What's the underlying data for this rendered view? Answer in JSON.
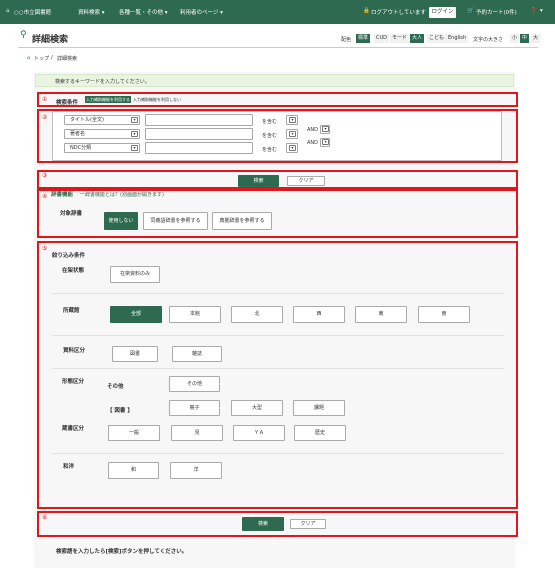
{
  "nav": {
    "site_title": "○○市立図書館",
    "menu": [
      "資料検索 ▾",
      "各種一覧・その他 ▾",
      "利用者のページ ▾"
    ],
    "logout_status": "ログアウトしています",
    "login_label": "ログイン",
    "cart_label": "予約カート(0件)",
    "help_label": "▾"
  },
  "header": {
    "page_title": "詳細検索",
    "color_label": "配色",
    "color_options": [
      "標準",
      "CUD",
      "モード"
    ],
    "lang_options": [
      "大人",
      "こども",
      "English"
    ],
    "fontsize_label": "文字の大きさ",
    "fontsize_options": [
      "小",
      "中",
      "大"
    ]
  },
  "breadcrumb": {
    "home": "トップ",
    "separator": "/",
    "current": "詳細検索"
  },
  "notice": "検索するキーワードを入力してください。",
  "markers": [
    "①",
    "②",
    "③",
    "④",
    "⑤",
    "⑥"
  ],
  "search_condition": {
    "label": "検索条件",
    "tag_use": "入力補助機能を利用する",
    "tag_nouse": "入力補助機能を利用しない"
  },
  "criteria_rows": [
    {
      "field": "タイトル(全文)",
      "match": "を含む"
    },
    {
      "field": "著者名",
      "match": "を含む",
      "op": "AND"
    },
    {
      "field": "NDC分類",
      "match": "を含む",
      "op": "AND"
    }
  ],
  "buttons": {
    "search": "検索",
    "clear": "クリア"
  },
  "dictionary": {
    "heading": "辞書機能",
    "link": "一辞書機能とは？(別画面が開きます)",
    "target_label": "対象辞書",
    "options": [
      "使用しない",
      "同義語辞書を参照する",
      "典拠辞書を参照する"
    ]
  },
  "filters": {
    "heading": "絞り込み条件",
    "stock": {
      "label": "在架状態",
      "options": [
        "在架資料のみ"
      ]
    },
    "location": {
      "label": "所蔵館",
      "options": [
        "全部",
        "本館",
        "北",
        "西",
        "東",
        "南"
      ]
    },
    "material": {
      "label": "資料区分",
      "options": [
        "図書",
        "雑誌"
      ]
    },
    "form": {
      "label": "形態区分",
      "sub1": "その他",
      "sub1_options": [
        "その他"
      ],
      "sub2": "【 図書 】",
      "sub2_options": [
        "冊子",
        "大型",
        "課題"
      ]
    },
    "shelf": {
      "label": "蔵書区分",
      "options": [
        "一般",
        "児",
        "ＹＡ",
        "歴史"
      ]
    },
    "lang": {
      "label": "和洋",
      "options": [
        "和",
        "洋"
      ]
    }
  },
  "footer_note": "検索語を入力したら[検索]ボタンを押してください。"
}
